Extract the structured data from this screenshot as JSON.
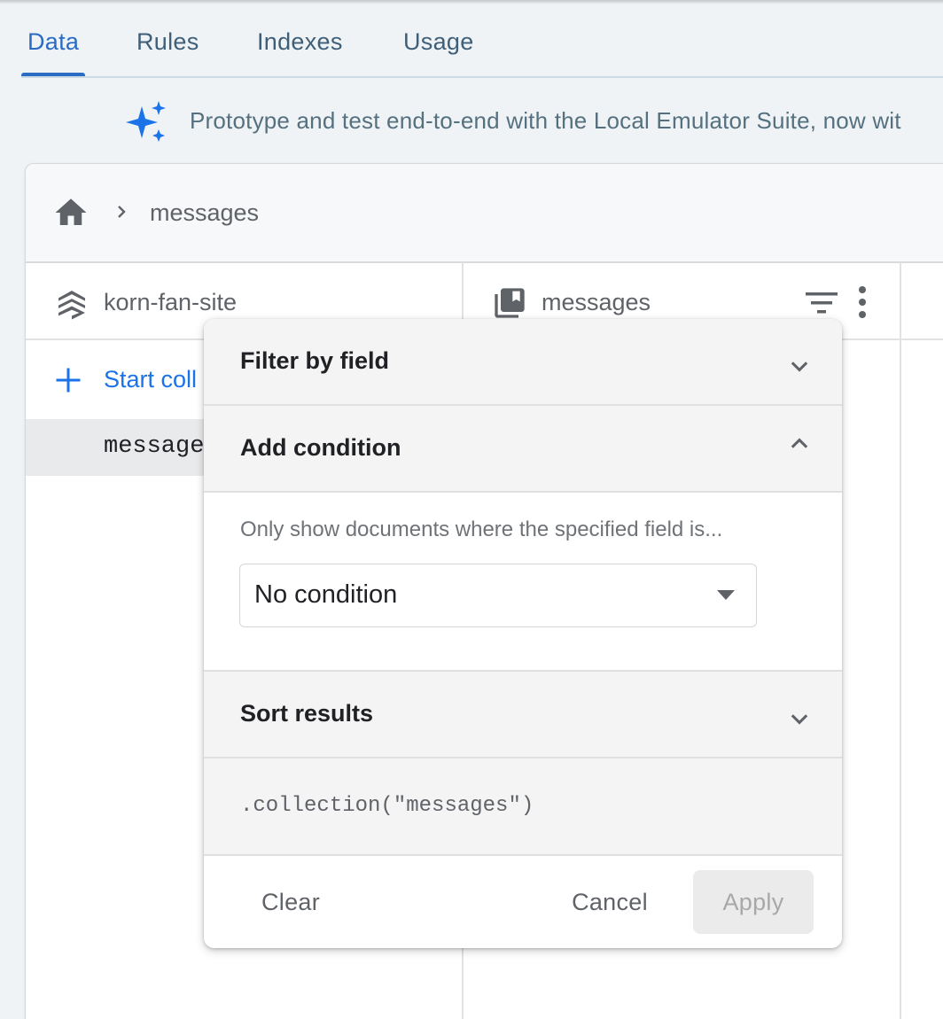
{
  "tabs": [
    {
      "label": "Data",
      "active": true
    },
    {
      "label": "Rules",
      "active": false
    },
    {
      "label": "Indexes",
      "active": false
    },
    {
      "label": "Usage",
      "active": false
    }
  ],
  "banner": {
    "icon": "sparkle-icon",
    "text": "Prototype and test end-to-end with the Local Emulator Suite, now wit"
  },
  "breadcrumb": {
    "home_icon": "home-icon",
    "separator_icon": "chevron-right-icon",
    "current": "messages"
  },
  "columns": {
    "database": {
      "icon": "firestore-stack-icon",
      "name": "korn-fan-site"
    },
    "collection": {
      "icon": "collection-icon",
      "name": "messages"
    }
  },
  "collection_list": {
    "add_label": "Start coll",
    "items": [
      "message"
    ]
  },
  "filter_popup": {
    "filter_by_field": {
      "label": "Filter by field",
      "expanded": false
    },
    "add_condition": {
      "label": "Add condition",
      "expanded": true,
      "help": "Only show documents where the specified field is...",
      "condition_value": "No condition"
    },
    "sort_results": {
      "label": "Sort results",
      "expanded": false
    },
    "query_preview": ".collection(\"messages\")",
    "buttons": {
      "clear": "Clear",
      "cancel": "Cancel",
      "apply": "Apply"
    }
  },
  "colors": {
    "accent": "#2a6bc4",
    "link": "#1a73e8",
    "banner_text": "#55707f",
    "page_background": "#eff3f6"
  }
}
